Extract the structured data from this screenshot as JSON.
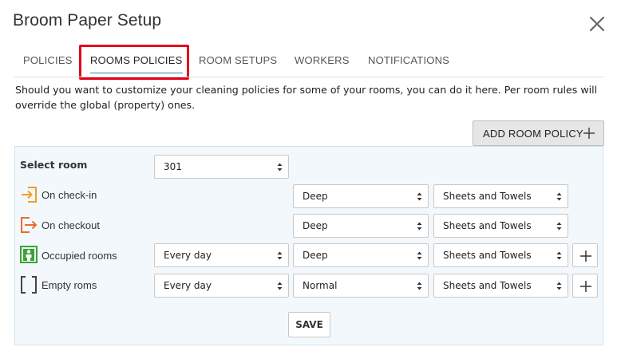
{
  "dialog": {
    "title": "Broom Paper Setup"
  },
  "tabs": [
    {
      "label": "POLICIES",
      "active": false
    },
    {
      "label": "ROOMS POLICIES",
      "active": true
    },
    {
      "label": "ROOM SETUPS",
      "active": false
    },
    {
      "label": "WORKERS",
      "active": false
    },
    {
      "label": "NOTIFICATIONS",
      "active": false
    }
  ],
  "description": "Should you want to customize your cleaning policies for some of your rooms, you can do it here. Per room rules will override the global (property) ones.",
  "add_button": {
    "label": "ADD ROOM POLICY"
  },
  "select_room": {
    "label": "Select room",
    "value": "301"
  },
  "rows": [
    {
      "label": "On check-in",
      "icon": "checkin-icon",
      "frequency": "",
      "cleaning": "Deep",
      "linen": "Sheets and Towels"
    },
    {
      "label": "On checkout",
      "icon": "checkout-icon",
      "frequency": "",
      "cleaning": "Deep",
      "linen": "Sheets and Towels"
    },
    {
      "label": "Occupied rooms",
      "icon": "occupied-room-icon",
      "frequency": "Every day",
      "cleaning": "Deep",
      "linen": "Sheets and Towels"
    },
    {
      "label": "Empty roms",
      "icon": "empty-room-icon",
      "frequency": "Every day",
      "cleaning": "Normal",
      "linen": "Sheets and Towels"
    }
  ],
  "save_button": {
    "label": "SAVE"
  },
  "colors": {
    "accent_underline": "#2a8ca3",
    "highlight": "#e3001b",
    "checkin_orange": "#f39c2b",
    "checkout_orange": "#ec6a2c",
    "occupied_green": "#3aa335",
    "panel_bg": "#f2f8fc"
  }
}
